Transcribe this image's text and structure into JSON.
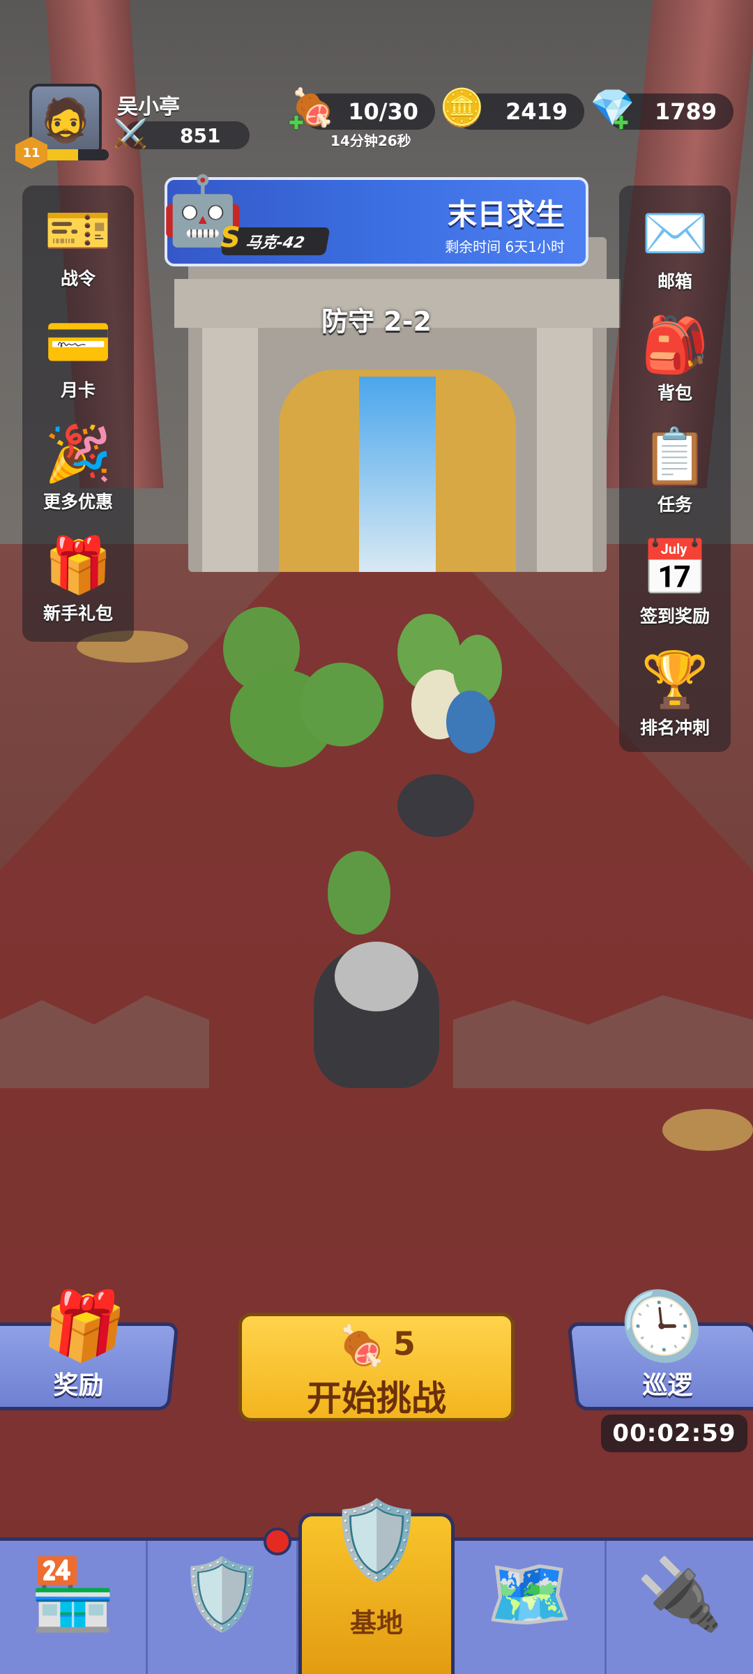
{
  "player": {
    "name": "吴小亭",
    "level": "11",
    "power": "851",
    "exp_fraction": 0.55
  },
  "resources": {
    "stamina": "10/30",
    "stamina_timer": "14分钟26秒",
    "gold": "2419",
    "diamonds": "1789"
  },
  "event": {
    "title": "末日求生",
    "remaining": "剩余时间 6天1小时",
    "grade": "S",
    "hero_name": "马克-42"
  },
  "stage": {
    "label": "防守 2-2"
  },
  "left_menu": [
    {
      "label": "战令",
      "icon": "battle-pass-ticket-icon",
      "glyph": "🎫"
    },
    {
      "label": "月卡",
      "icon": "monthly-card-icon",
      "glyph": "💳"
    },
    {
      "label": "更多优惠",
      "icon": "party-popper-icon",
      "glyph": "🎉"
    },
    {
      "label": "新手礼包",
      "icon": "gift-box-icon",
      "glyph": "🎁"
    }
  ],
  "right_menu": [
    {
      "label": "邮箱",
      "icon": "mail-envelope-icon",
      "glyph": "✉️"
    },
    {
      "label": "背包",
      "icon": "backpack-icon",
      "glyph": "🎒"
    },
    {
      "label": "任务",
      "icon": "task-clipboard-icon",
      "glyph": "📋"
    },
    {
      "label": "签到奖励",
      "icon": "calendar-icon",
      "glyph": "📅"
    },
    {
      "label": "排名冲刺",
      "icon": "ranking-podium-icon",
      "glyph": "🏆"
    }
  ],
  "actions": {
    "reward_label": "奖励",
    "patrol_label": "巡逻",
    "patrol_timer": "00:02:59",
    "start_cost": "5",
    "start_label": "开始挑战"
  },
  "nav": {
    "base_label": "基地"
  }
}
